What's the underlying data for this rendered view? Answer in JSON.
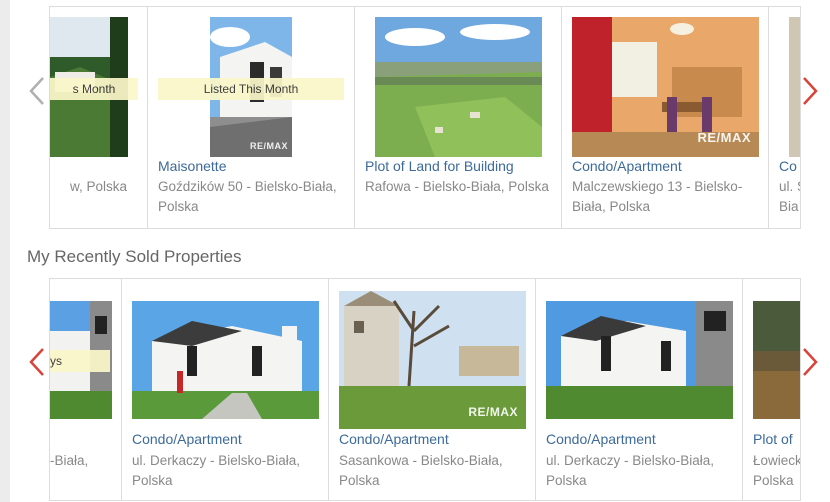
{
  "top_carousel": {
    "cards": [
      {
        "badge": "Listed This Month",
        "badge_visible": "s Month",
        "type": "",
        "address": "w, Polska"
      },
      {
        "badge": "Listed This Month",
        "type": "Maisonette",
        "address": "Goździków 50 - Bielsko-Biała, Polska"
      },
      {
        "type": "Plot of Land for Building",
        "address": "Rafowa - Bielsko-Biała, Polska"
      },
      {
        "type": "Condo/Apartment",
        "address": "Malczewskiego 13 - Bielsko-Biała, Polska"
      },
      {
        "type": "Co",
        "address_lines": [
          "ul. S",
          "Bia"
        ]
      }
    ]
  },
  "sold_section": {
    "title": "My Recently Sold Properties",
    "cards": [
      {
        "badge_visible": "ys",
        "address": "-Biała,"
      },
      {
        "type": "Condo/Apartment",
        "address": "ul. Derkaczy - Bielsko-Biała, Polska"
      },
      {
        "type": "Condo/Apartment",
        "address": "Sasankowa - Bielsko-Biała, Polska"
      },
      {
        "type": "Condo/Apartment",
        "address": "ul. Derkaczy - Bielsko-Biała, Polska"
      },
      {
        "type": "Plot of",
        "address_lines": [
          "Łowieck",
          "Polska"
        ]
      }
    ]
  },
  "watermark": "RE/MAX",
  "colors": {
    "link": "#3c6a9a",
    "arrow_red": "#d9433a",
    "arrow_gray": "#b0b0b0",
    "ribbon": "#fbf7c9"
  }
}
